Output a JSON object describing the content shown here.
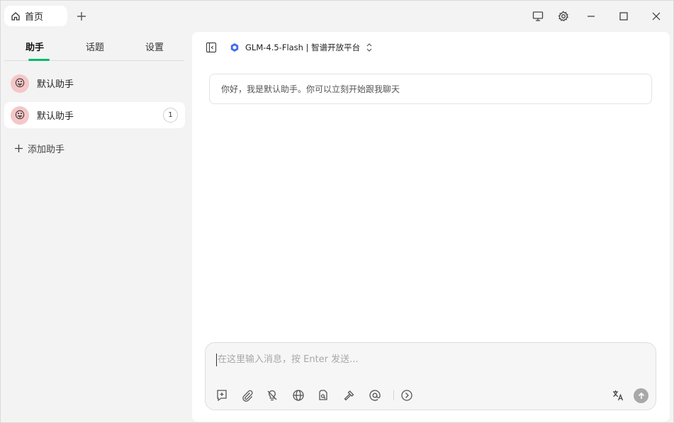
{
  "window": {
    "tab_label": "首页",
    "tab_icon": "home-icon",
    "controls": [
      "monitor-icon",
      "gear-icon",
      "minimize-icon",
      "maximize-icon",
      "close-icon"
    ]
  },
  "sidebar": {
    "tabs": [
      {
        "label": "助手",
        "active": true
      },
      {
        "label": "话题",
        "active": false
      },
      {
        "label": "设置",
        "active": false
      }
    ],
    "assistants": [
      {
        "name": "默认助手",
        "avatar": "😛",
        "selected": false,
        "count": ""
      },
      {
        "name": "默认助手",
        "avatar": "😛",
        "selected": true,
        "count": "1"
      }
    ],
    "add_label": "添加助手"
  },
  "main": {
    "model_label": "GLM-4.5-Flash | 智谱开放平台",
    "greeting": "你好，我是默认助手。你可以立刻开始跟我聊天",
    "input_placeholder": "在这里输入消息，按 Enter 发送...",
    "tools": [
      "new-topic-icon",
      "attachment-icon",
      "thinking-off-icon",
      "web-search-icon",
      "knowledge-base-icon",
      "mcp-tools-icon",
      "mention-icon",
      "expand-icon"
    ],
    "translate_icon": "translate-icon",
    "send_icon": "send-arrow-icon"
  },
  "colors": {
    "accent": "#00b96b",
    "model_logo": "#3f6af0",
    "send_disabled": "#a8a8a8"
  }
}
